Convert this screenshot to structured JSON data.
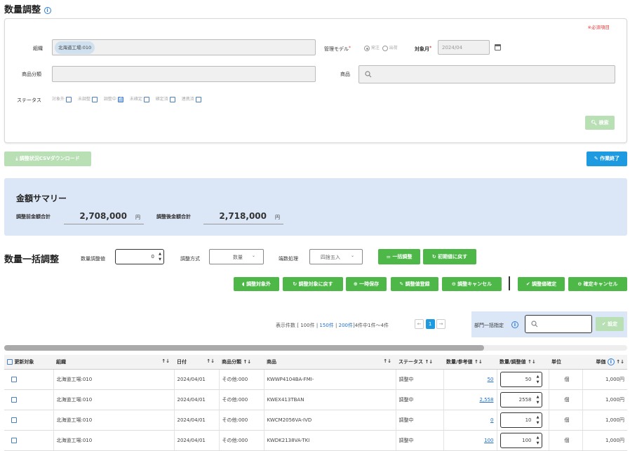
{
  "page": {
    "title": "数量調整"
  },
  "filter": {
    "required_note": "※必須項目",
    "org_label": "組織",
    "org_chip": "北海道工場:010",
    "model_label": "管理モデル",
    "model_opt1": "発注",
    "model_opt2": "出荷",
    "target_month_label": "対象月",
    "target_month_value": "2024/04",
    "category_label": "商品分類",
    "product_label": "商品",
    "status_label": "ステータス",
    "statuses": [
      "対象外",
      "未調整",
      "調整中",
      "未確定",
      "確定済",
      "連携済"
    ],
    "status_checked": [
      false,
      false,
      true,
      false,
      false,
      false
    ],
    "search_button": "検索"
  },
  "actions": {
    "csv_download": "調整状況CSVダウンロード",
    "finish_work": "作業終了"
  },
  "summary": {
    "title": "金額サマリー",
    "before_label": "調整前金額合計",
    "before_value": "2,708,000",
    "before_unit": "円",
    "after_label": "調整後金額合計",
    "after_value": "2,718,000",
    "after_unit": "円"
  },
  "bulk": {
    "title": "数量一括調整",
    "qty_label": "数量調整値",
    "qty_value": "0",
    "method_label": "調整方式",
    "method_value": "数量",
    "rounding_label": "端数処理",
    "rounding_value": "四捨五入",
    "bulk_adjust": "一括調整",
    "reset_initial": "初期値に戻す",
    "exclude": "調整対象外",
    "return_target": "調整対象に戻す",
    "temp_save": "一時保存",
    "register": "調整値登録",
    "cancel_adjust": "調整キャンセル",
    "confirm": "調整値確定",
    "cancel_confirm": "確定キャンセル"
  },
  "pagination": {
    "prefix": "表示件数",
    "open_bracket": "[",
    "size1": "100件",
    "sep1": "|",
    "size2": "150件",
    "sep2": "|",
    "size3": "200件",
    "close_info": "]4件中1件〜4件",
    "current_page": "1",
    "prev": "←",
    "next": "→"
  },
  "dept": {
    "label": "部門一括指定",
    "set_button": "設定"
  },
  "table": {
    "headers": {
      "update": "更新対象",
      "org": "組織",
      "date": "日付",
      "category": "商品分類",
      "product": "商品",
      "status": "ステータス",
      "ref": "数量/参考値",
      "adjust": "数量/調整値",
      "unit": "単位",
      "price": "単価"
    },
    "rows": [
      {
        "org": "北海道工場:010",
        "date": "2024/04/01",
        "category": "その他:000",
        "product": "KWWP4104BA-FMI-",
        "status": "調整中",
        "ref": "50",
        "adjust": "50",
        "unit": "個",
        "price": "1,000円"
      },
      {
        "org": "北海道工場:010",
        "date": "2024/04/01",
        "category": "その他:000",
        "product": "KWEX413TBAN",
        "status": "調整中",
        "ref": "2,558",
        "adjust": "2558",
        "unit": "個",
        "price": "1,000円"
      },
      {
        "org": "北海道工場:010",
        "date": "2024/04/01",
        "category": "その他:000",
        "product": "KWCM2056VA-IVD",
        "status": "調整中",
        "ref": "0",
        "adjust": "10",
        "unit": "個",
        "price": "1,000円"
      },
      {
        "org": "北海道工場:010",
        "date": "2024/04/01",
        "category": "その他:000",
        "product": "KWDK2138VA-TKI",
        "status": "調整中",
        "ref": "100",
        "adjust": "100",
        "unit": "個",
        "price": "1,000円"
      }
    ]
  },
  "colors": {
    "accent_green": "#4db848",
    "accent_blue": "#1e9be0",
    "summary_bg": "#dbe7f6",
    "link": "#1e6fd0"
  }
}
